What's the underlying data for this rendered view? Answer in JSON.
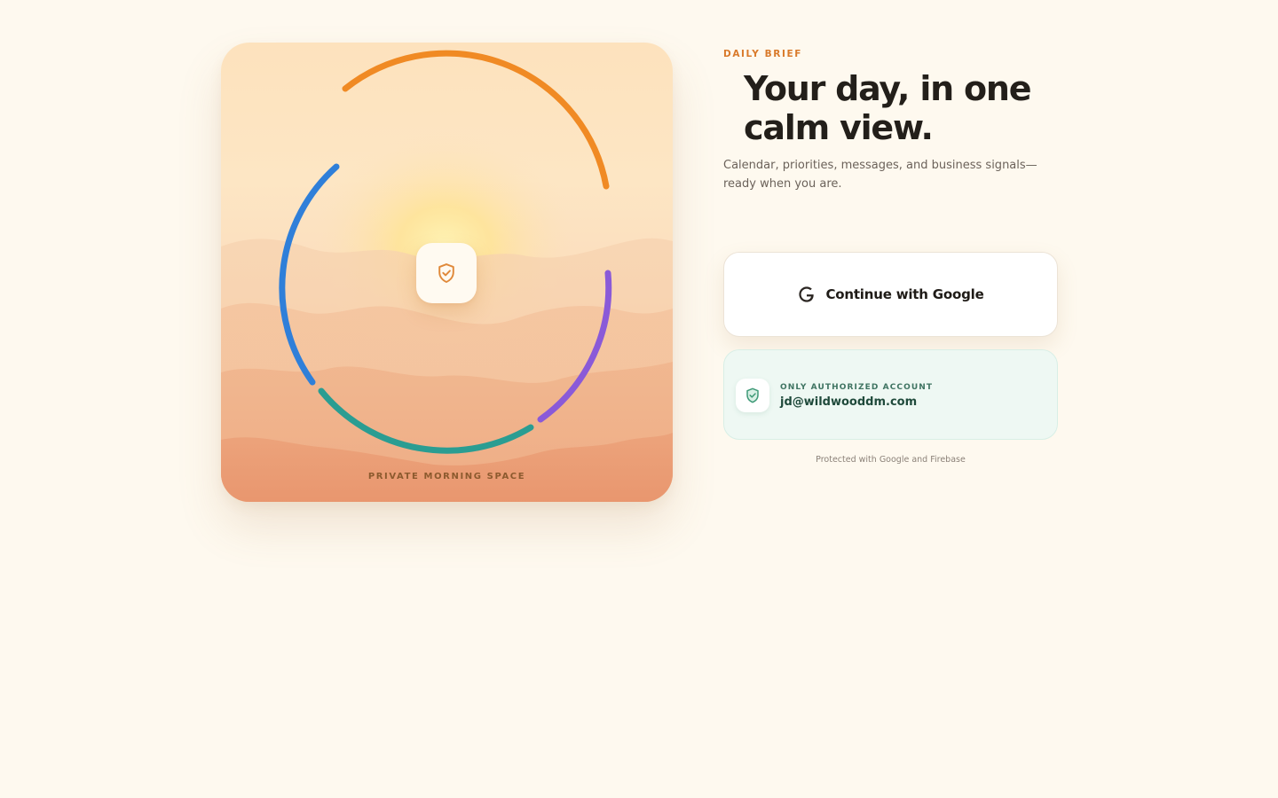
{
  "hero": {
    "caption": "PRIVATE MORNING SPACE",
    "center_icon": "shield-check-icon",
    "ring_colors": [
      "#f08a24",
      "#8a5ad8",
      "#2a9d92",
      "#2f7fd9"
    ]
  },
  "intro": {
    "eyebrow": "DAILY BRIEF",
    "headline": "Your day, in one calm view.",
    "subtitle": "Calendar, priorities, messages, and business signals—ready when you are."
  },
  "google_button": {
    "icon": "google-g-icon",
    "label": "Continue with Google"
  },
  "authorized_account": {
    "icon": "shield-check-icon",
    "label": "ONLY AUTHORIZED ACCOUNT",
    "email": "jd@wildwooddm.com"
  },
  "footnote": "Protected with Google and Firebase",
  "colors": {
    "background": "#fef9ef",
    "accent": "#d97a2b",
    "headline": "#231f1a",
    "account_panel": "#eef8f3"
  }
}
